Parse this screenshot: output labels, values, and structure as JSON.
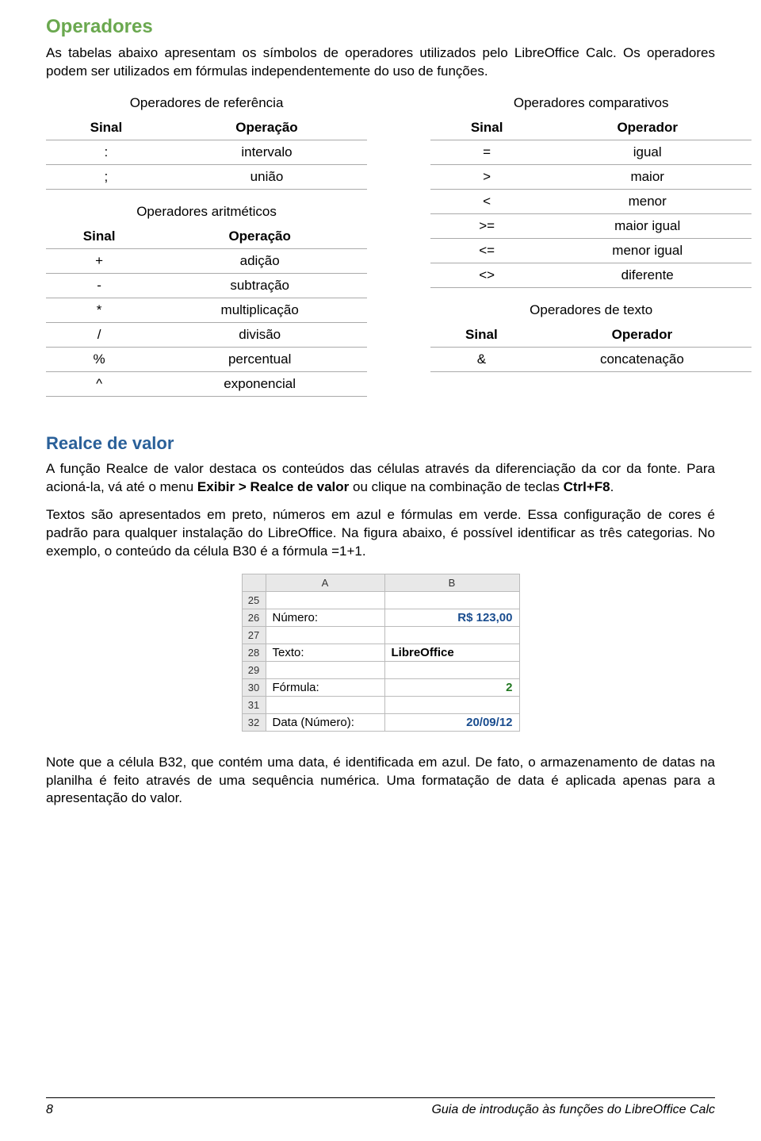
{
  "h1": "Operadores",
  "intro": "As tabelas abaixo apresentam os símbolos de operadores utilizados pelo LibreOffice Calc. Os operadores podem ser utilizados em fórmulas independentemente do uso de funções.",
  "tables": {
    "ref": {
      "caption": "Operadores de referência",
      "headers": [
        "Sinal",
        "Operação"
      ],
      "rows": [
        [
          ":",
          "intervalo"
        ],
        [
          ";",
          "união"
        ]
      ]
    },
    "arit": {
      "caption": "Operadores aritméticos",
      "headers": [
        "Sinal",
        "Operação"
      ],
      "rows": [
        [
          "+",
          "adição"
        ],
        [
          "-",
          "subtração"
        ],
        [
          "*",
          "multiplicação"
        ],
        [
          "/",
          "divisão"
        ],
        [
          "%",
          "percentual"
        ],
        [
          "^",
          "exponencial"
        ]
      ]
    },
    "comp": {
      "caption": "Operadores comparativos",
      "headers": [
        "Sinal",
        "Operador"
      ],
      "rows": [
        [
          "=",
          "igual"
        ],
        [
          ">",
          "maior"
        ],
        [
          "<",
          "menor"
        ],
        [
          ">=",
          "maior igual"
        ],
        [
          "<=",
          "menor igual"
        ],
        [
          "<>",
          "diferente"
        ]
      ]
    },
    "text": {
      "caption": "Operadores de texto",
      "headers": [
        "Sinal",
        "Operador"
      ],
      "rows": [
        [
          "&",
          "concatenação"
        ]
      ]
    }
  },
  "h2": "Realce de valor",
  "para1_pre": "A função Realce de valor destaca os conteúdos das células através da diferenciação da cor da fonte. Para acioná-la, vá até o menu ",
  "para1_bold1": "Exibir > Realce de valor",
  "para1_mid": " ou clique na combinação de teclas ",
  "para1_bold2": "Ctrl+F8",
  "para1_post": ".",
  "para2": "Textos são apresentados em preto, números em azul e fórmulas em verde. Essa configuração de cores é padrão para qualquer instalação do LibreOffice. Na figura abaixo, é possível identificar as três categorias. No exemplo, o conteúdo da célula B30 é a fórmula =1+1.",
  "sheet": {
    "cols": [
      "A",
      "B"
    ],
    "rows": [
      {
        "n": "25",
        "a": "",
        "b": ""
      },
      {
        "n": "26",
        "a": "Número:",
        "b": "R$ 123,00",
        "bclass": "num-blue"
      },
      {
        "n": "27",
        "a": "",
        "b": ""
      },
      {
        "n": "28",
        "a": "Texto:",
        "b": "LibreOffice",
        "bclass": "text-black"
      },
      {
        "n": "29",
        "a": "",
        "b": ""
      },
      {
        "n": "30",
        "a": "Fórmula:",
        "b": "2",
        "bclass": "formula-green"
      },
      {
        "n": "31",
        "a": "",
        "b": ""
      },
      {
        "n": "32",
        "a": "Data (Número):",
        "b": "20/09/12",
        "bclass": "num-blue"
      }
    ]
  },
  "para3": "Note que a célula B32, que contém uma data, é identificada em azul. De fato, o armazenamento de datas na planilha é feito através de uma sequência numérica. Uma formatação de data é aplicada apenas para a apresentação do valor.",
  "footer": {
    "page": "8",
    "title": "Guia de introdução às funções do LibreOffice Calc"
  }
}
